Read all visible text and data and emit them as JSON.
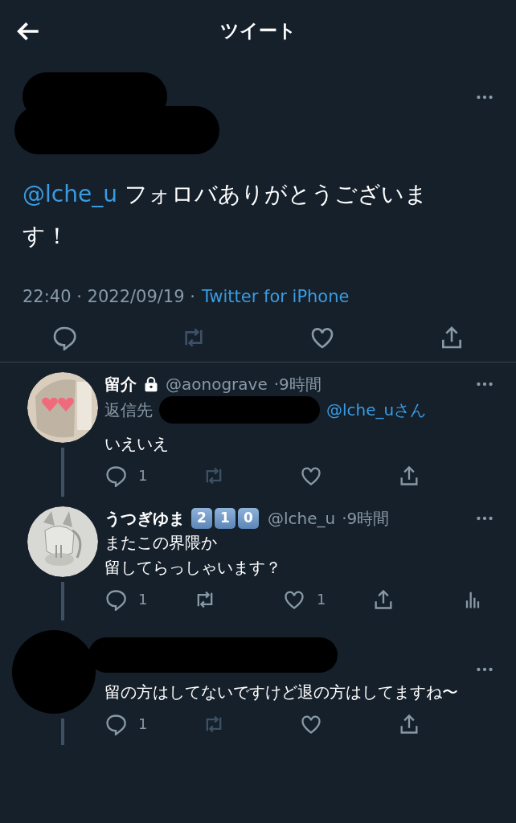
{
  "header": {
    "title": "ツイート"
  },
  "main_tweet": {
    "author_redacted": true,
    "mention": "@lche_u",
    "text": "フォロバありがとうございます！",
    "meta": "22:40 · 2022/09/19 ·",
    "source": "Twitter for iPhone",
    "actions": [
      {
        "kind": "reply",
        "disabled": false
      },
      {
        "kind": "retweet",
        "disabled": true
      },
      {
        "kind": "like",
        "disabled": false
      },
      {
        "kind": "share",
        "disabled": false
      }
    ]
  },
  "replies": [
    {
      "author_redacted": false,
      "name": "留介",
      "locked": true,
      "handle": "@aonograve",
      "time": "·9時間",
      "reply_to": {
        "label": "返信先",
        "redacted": true,
        "mention": "@lche_u",
        "suffix": "さん"
      },
      "lines": [
        "いえいえ"
      ],
      "thread_below": true,
      "actions": [
        {
          "kind": "reply",
          "count": "1",
          "disabled": false
        },
        {
          "kind": "retweet",
          "disabled": true
        },
        {
          "kind": "like",
          "disabled": false
        },
        {
          "kind": "share",
          "disabled": false
        }
      ]
    },
    {
      "author_redacted": false,
      "name": "うつぎゆま",
      "locked": false,
      "badges": [
        "2",
        "1",
        "0"
      ],
      "handle": "@lche_u",
      "time": "·9時間",
      "lines": [
        "またこの界隈か",
        "留してらっしゃいます？"
      ],
      "thread_below": true,
      "actions": [
        {
          "kind": "reply",
          "count": "1",
          "disabled": false
        },
        {
          "kind": "retweet",
          "disabled": false
        },
        {
          "kind": "like",
          "count": "1",
          "disabled": false
        },
        {
          "kind": "share",
          "disabled": false
        },
        {
          "kind": "analytics",
          "disabled": false
        }
      ]
    },
    {
      "author_redacted": true,
      "lines": [
        "留の方はしてないですけど退の方はしてますね〜"
      ],
      "thread_below": true,
      "actions": [
        {
          "kind": "reply",
          "count": "1",
          "disabled": false
        },
        {
          "kind": "retweet",
          "disabled": true
        },
        {
          "kind": "like",
          "disabled": false
        },
        {
          "kind": "share",
          "disabled": false
        }
      ]
    }
  ]
}
